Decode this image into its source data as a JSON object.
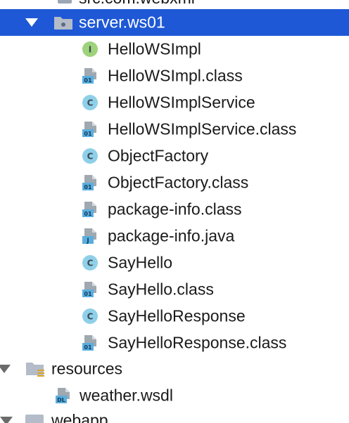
{
  "tree": {
    "partial_top": {
      "label": "src.com.webxml"
    },
    "selected_folder": {
      "label": "server.ws01"
    },
    "files": [
      {
        "label": "HelloWSImpl",
        "icon": "interface-icon",
        "badge": "I"
      },
      {
        "label": "HelloWSImpl.class",
        "icon": "class-file-icon",
        "badge": "01"
      },
      {
        "label": "HelloWSImplService",
        "icon": "class-icon",
        "badge": "C"
      },
      {
        "label": "HelloWSImplService.class",
        "icon": "class-file-icon",
        "badge": "01"
      },
      {
        "label": "ObjectFactory",
        "icon": "class-icon",
        "badge": "C"
      },
      {
        "label": "ObjectFactory.class",
        "icon": "class-file-icon",
        "badge": "01"
      },
      {
        "label": "package-info.class",
        "icon": "class-file-icon",
        "badge": "01"
      },
      {
        "label": "package-info.java",
        "icon": "java-file-icon",
        "badge": "J"
      },
      {
        "label": "SayHello",
        "icon": "class-icon",
        "badge": "C"
      },
      {
        "label": "SayHello.class",
        "icon": "class-file-icon",
        "badge": "01"
      },
      {
        "label": "SayHelloResponse",
        "icon": "class-icon",
        "badge": "C"
      },
      {
        "label": "SayHelloResponse.class",
        "icon": "class-file-icon",
        "badge": "01"
      }
    ],
    "resources_folder": {
      "label": "resources"
    },
    "resource_files": [
      {
        "label": "weather.wsdl",
        "icon": "wsdl-file-icon",
        "badge": "DL"
      }
    ],
    "partial_bottom": {
      "label": "webapp"
    }
  },
  "colors": {
    "selection": "#1e58d6",
    "class_badge": "#8fd0e8",
    "interface_badge": "#9ed27b",
    "file_badge": "#5aaedf",
    "folder": "#9ba7b5"
  }
}
